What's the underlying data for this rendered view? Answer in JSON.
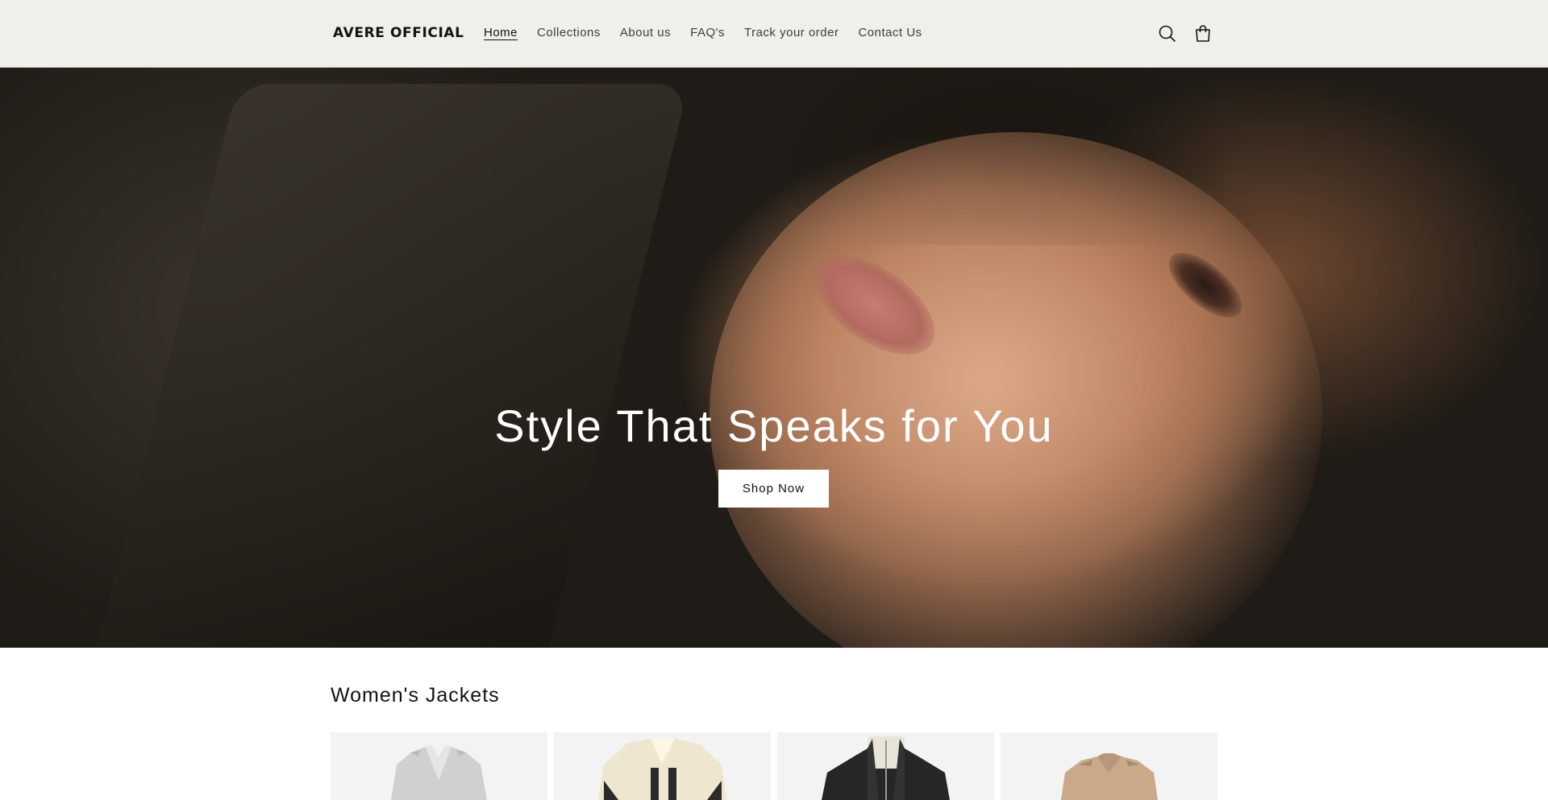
{
  "header": {
    "logo": "AVERE OFFICIAL",
    "nav": [
      {
        "label": "Home",
        "active": true
      },
      {
        "label": "Collections",
        "active": false
      },
      {
        "label": "About us",
        "active": false
      },
      {
        "label": "FAQ's",
        "active": false
      },
      {
        "label": "Track your order",
        "active": false
      },
      {
        "label": "Contact Us",
        "active": false
      }
    ],
    "icons": [
      "search-icon",
      "cart-icon"
    ]
  },
  "hero": {
    "title": "Style That Speaks for You",
    "button_label": "Shop Now"
  },
  "collection": {
    "title": "Women's Jackets",
    "products": [
      {
        "name": "light-grey-trench-jacket"
      },
      {
        "name": "cream-shearling-jacket"
      },
      {
        "name": "black-leather-zip-jacket"
      },
      {
        "name": "beige-trench-jacket"
      }
    ]
  },
  "colors": {
    "header_bg": "#f1efe9",
    "text": "#121212",
    "button_bg": "#ffffff"
  }
}
